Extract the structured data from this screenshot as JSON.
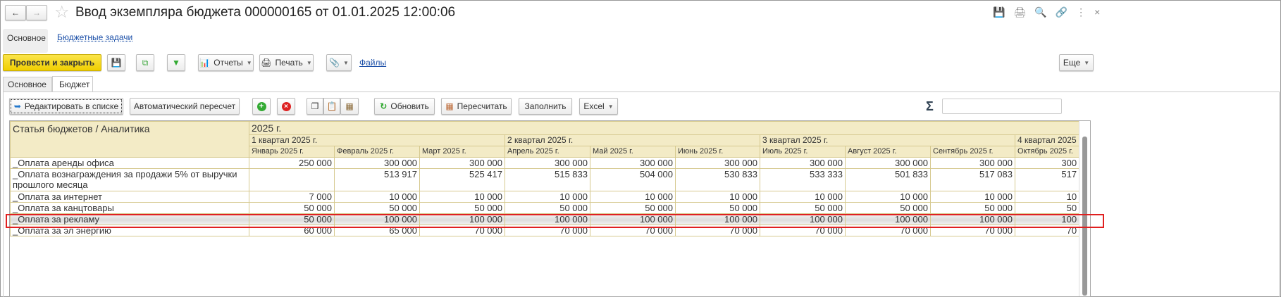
{
  "window": {
    "title": "Ввод экземпляра бюджета 000000165 от 01.01.2025 12:00:06"
  },
  "nav": {
    "items": [
      "Основное",
      "Бюджетные задачи"
    ]
  },
  "commands": {
    "post_close": "Провести и закрыть",
    "reports": "Отчеты",
    "print": "Печать",
    "files": "Файлы",
    "more": "Еще"
  },
  "tabs": [
    "Основное",
    "Бюджет"
  ],
  "table_toolbar": {
    "edit_list": "Редактировать в списке",
    "auto_recalc": "Автоматический пересчет",
    "refresh": "Обновить",
    "recalc": "Пересчитать",
    "fill": "Заполнить",
    "excel": "Excel",
    "sum_symbol": "Σ",
    "sum_value": ""
  },
  "accent": {
    "primary_button": "#f5d80f",
    "header_bg": "#f3ebc6",
    "highlight": "#e02020"
  },
  "table": {
    "header_name": "Статья бюджетов / Аналитика",
    "year": "2025 г.",
    "quarters": [
      "1 квартал 2025 г.",
      "2 квартал 2025 г.",
      "3 квартал 2025 г.",
      "4 квартал 2025"
    ],
    "months": [
      "Январь 2025 г.",
      "Февраль 2025 г.",
      "Март 2025 г.",
      "Апрель 2025 г.",
      "Май 2025 г.",
      "Июнь 2025 г.",
      "Июль 2025 г.",
      "Август 2025 г.",
      "Сентябрь 2025 г.",
      "Октябрь 2025 г."
    ],
    "rows": [
      {
        "name": "_Оплата аренды офиса",
        "values": [
          "250 000",
          "300 000",
          "300 000",
          "300 000",
          "300 000",
          "300 000",
          "300 000",
          "300 000",
          "300 000",
          "300"
        ]
      },
      {
        "name": "_Оплата вознаграждения  за продажи 5% от выручки прошлого месяца",
        "values": [
          "",
          "513 917",
          "525 417",
          "515 833",
          "504 000",
          "530 833",
          "533 333",
          "501 833",
          "517 083",
          "517"
        ]
      },
      {
        "name": "_Оплата за интернет",
        "values": [
          "7 000",
          "10 000",
          "10 000",
          "10 000",
          "10 000",
          "10 000",
          "10 000",
          "10 000",
          "10 000",
          "10"
        ]
      },
      {
        "name": "_Оплата за канцтовары",
        "values": [
          "50 000",
          "50 000",
          "50 000",
          "50 000",
          "50 000",
          "50 000",
          "50 000",
          "50 000",
          "50 000",
          "50"
        ]
      },
      {
        "name": "_Оплата за рекламу",
        "values": [
          "50 000",
          "100 000",
          "100 000",
          "100 000",
          "100 000",
          "100 000",
          "100 000",
          "100 000",
          "100 000",
          "100"
        ],
        "highlighted": true
      },
      {
        "name": "_Оплата за эл энергию",
        "values": [
          "60 000",
          "65 000",
          "70 000",
          "70 000",
          "70 000",
          "70 000",
          "70 000",
          "70 000",
          "70 000",
          "70"
        ]
      }
    ]
  }
}
